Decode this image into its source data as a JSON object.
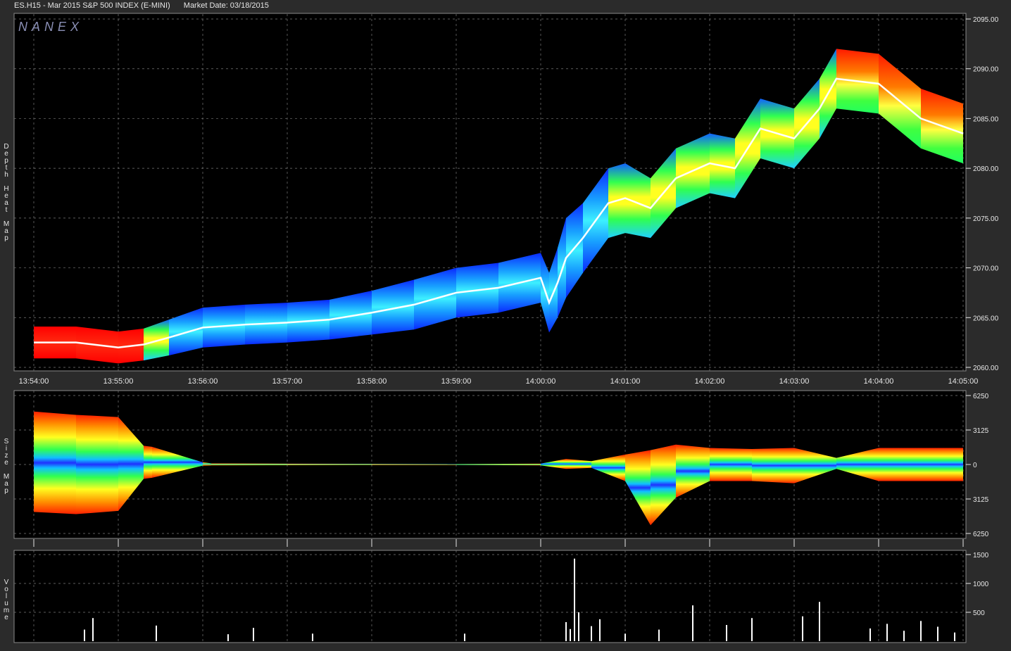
{
  "header": {
    "symbol": "ES.H15 - Mar 2015 S&P 500 INDEX (E-MINI)",
    "market_date": "Market Date: 03/18/2015"
  },
  "watermark": "NANEX",
  "side_labels": {
    "depth": "D\ne\np\nt\nh\n\nH\ne\na\nt\n\nM\na\np",
    "size": "S\ni\nz\ne\n\nM\na\np",
    "volume": "V\no\nl\nu\nm\ne"
  },
  "colors": {
    "background": "#000000",
    "frame": "#2b2b2b",
    "grid": "#7a7a7a",
    "price_line": "#ffffff",
    "heat_low": "#1e3cff",
    "heat_mid": "#2fff2f",
    "heat_high": "#ff1a1a"
  },
  "chart_data": [
    {
      "name": "Depth Heat Map",
      "type": "area",
      "x_ticks": [
        "13:54:00",
        "13:55:00",
        "13:56:00",
        "13:57:00",
        "13:58:00",
        "13:59:00",
        "14:00:00",
        "14:01:00",
        "14:02:00",
        "14:03:00",
        "14:04:00",
        "14:05:00"
      ],
      "y_ticks": [
        "2095.00",
        "2090.00",
        "2085.00",
        "2080.00",
        "2075.00",
        "2070.00",
        "2065.00",
        "2060.00"
      ],
      "ylim": [
        2060,
        2095
      ],
      "x_minutes": [
        0,
        0.5,
        1.0,
        1.3,
        1.6,
        2.0,
        2.5,
        3.0,
        3.5,
        4.0,
        4.5,
        5.0,
        5.5,
        6.0,
        6.1,
        6.2,
        6.3,
        6.5,
        6.8,
        7.0,
        7.3,
        7.6,
        8.0,
        8.3,
        8.6,
        9.0,
        9.3,
        9.5,
        10.0,
        10.5,
        11.0
      ],
      "mid_price": [
        2062.5,
        2062.5,
        2062.0,
        2062.3,
        2063.0,
        2064.0,
        2064.3,
        2064.5,
        2064.8,
        2065.5,
        2066.3,
        2067.5,
        2068.0,
        2069.0,
        2066.5,
        2068.5,
        2071.0,
        2073.0,
        2076.5,
        2077.0,
        2076.0,
        2079.0,
        2080.5,
        2080.0,
        2084.0,
        2083.0,
        2086.0,
        2089.0,
        2088.5,
        2085.0,
        2083.5
      ],
      "band_half_width": [
        1.6,
        1.6,
        1.6,
        1.6,
        1.8,
        2.0,
        2.0,
        2.0,
        2.0,
        2.2,
        2.5,
        2.5,
        2.5,
        2.5,
        3.0,
        3.5,
        4.0,
        3.5,
        3.5,
        3.5,
        3.0,
        3.0,
        3.0,
        3.0,
        3.0,
        3.0,
        3.0,
        3.0,
        3.0,
        3.0,
        3.0
      ],
      "band_color": [
        "heat_high",
        "heat_high",
        "heat_high",
        "heat_mid",
        "heat_low",
        "heat_low",
        "heat_low",
        "heat_low",
        "heat_low",
        "heat_low",
        "heat_low",
        "heat_low",
        "heat_low",
        "heat_low",
        "heat_low",
        "heat_low",
        "heat_low",
        "heat_low",
        "heat_mid",
        "heat_mid",
        "heat_mid",
        "heat_mid",
        "heat_mid",
        "heat_mid",
        "heat_mid",
        "heat_mid",
        "heat_mid",
        "heat_high",
        "heat_high",
        "heat_high",
        "heat_high"
      ]
    },
    {
      "name": "Size Map",
      "type": "area",
      "y_ticks": [
        "6250",
        "3125",
        "0",
        "3125",
        "6250"
      ],
      "ylim": [
        -6250,
        6250
      ],
      "x_minutes": [
        0,
        0.5,
        1.0,
        1.3,
        1.4,
        2.0,
        2.1,
        3.0,
        4.0,
        5.0,
        6.0,
        6.3,
        6.6,
        7.0,
        7.3,
        7.6,
        8.0,
        8.5,
        9.0,
        9.5,
        10.0,
        10.5,
        11.0
      ],
      "upper": [
        4800,
        4500,
        4300,
        1700,
        1600,
        200,
        100,
        80,
        60,
        40,
        80,
        500,
        300,
        900,
        1300,
        1800,
        1500,
        1400,
        1500,
        600,
        1500,
        1500,
        1500
      ],
      "lower": [
        -4300,
        -4500,
        -4200,
        -1300,
        -1200,
        -100,
        -80,
        -60,
        -40,
        -40,
        -80,
        -400,
        -300,
        -1500,
        -5500,
        -3000,
        -1500,
        -1500,
        -1700,
        -400,
        -1500,
        -1500,
        -1500
      ]
    },
    {
      "name": "Volume",
      "type": "bar",
      "y_ticks": [
        "1500",
        "1000",
        "500"
      ],
      "ylim": [
        0,
        1500
      ],
      "x_minutes": [
        0.7,
        0.6,
        1.45,
        2.3,
        2.6,
        3.3,
        5.1,
        6.3,
        6.35,
        6.4,
        6.45,
        6.6,
        6.7,
        7.0,
        7.4,
        7.8,
        8.2,
        8.5,
        9.1,
        9.3,
        9.9,
        10.1,
        10.3,
        10.5,
        10.7,
        10.9
      ],
      "values": [
        400,
        200,
        270,
        120,
        230,
        130,
        130,
        330,
        210,
        1430,
        500,
        260,
        380,
        130,
        200,
        620,
        280,
        400,
        430,
        680,
        220,
        300,
        180,
        350,
        250,
        150
      ]
    }
  ]
}
